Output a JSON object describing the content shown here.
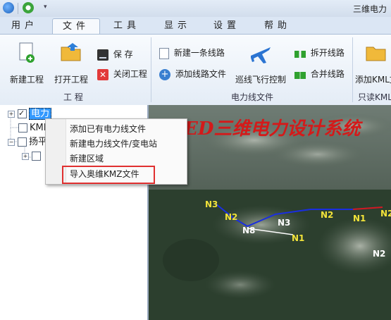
{
  "window": {
    "title": "三维电力"
  },
  "tabs": [
    {
      "label": "用户"
    },
    {
      "label": "文件"
    },
    {
      "label": "工具"
    },
    {
      "label": "显示"
    },
    {
      "label": "设置"
    },
    {
      "label": "帮助"
    }
  ],
  "ribbon": {
    "project_group": {
      "label": "工  程",
      "new_project": "新建工程",
      "open_project": "打开工程",
      "save": "保  存",
      "close_project": "关闭工程"
    },
    "line_group": {
      "label": "电力线文件",
      "new_line": "新建一条线路",
      "add_line_file": "添加线路文件",
      "flight_control": "巡线飞行控制",
      "split_line": "拆开线路",
      "merge_line": "合并线路"
    },
    "readonly_group": {
      "label": "只读KML文件",
      "add_kml": "添加KML文"
    }
  },
  "tree": {
    "items": [
      {
        "label": "电力",
        "checked": true
      },
      {
        "label": "KML"
      },
      {
        "label": "扬平"
      },
      {
        "label": ""
      }
    ]
  },
  "context_menu": {
    "items": [
      {
        "label": "添加已有电力线文件"
      },
      {
        "label": "新建电力线文件/变电站"
      },
      {
        "label": "新建区域"
      },
      {
        "label": "导入奥维KMZ文件"
      }
    ]
  },
  "map": {
    "overlay_title": "ED三维电力设计系统",
    "nodes": [
      "N3",
      "N2",
      "N8",
      "N3",
      "N2",
      "N1",
      "N1",
      "N2",
      "N2"
    ]
  },
  "colors": {
    "accent": "#3399ff",
    "highlight_box": "#e03030",
    "overlay_text": "#d41a1a",
    "node_label": "#f2e33a",
    "line_blue": "#1a2ee0",
    "line_red": "#d41a1a"
  }
}
